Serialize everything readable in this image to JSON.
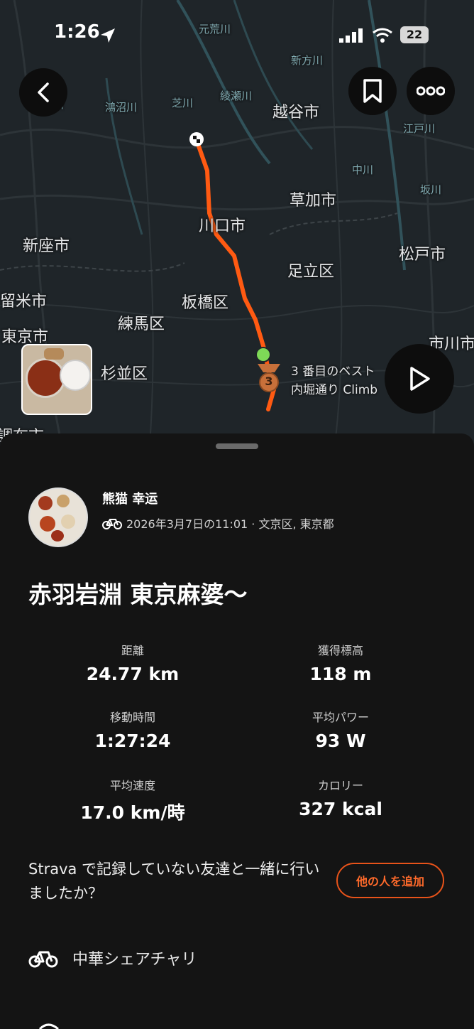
{
  "status_bar": {
    "time": "1:26",
    "battery": "22"
  },
  "map": {
    "labels": [
      "越谷市",
      "草加市",
      "川口市",
      "新座市",
      "足立区",
      "松戸市",
      "留米市",
      "板橋区",
      "練馬区",
      "東京市",
      "杉並区",
      "市川市",
      "調布市"
    ],
    "river_labels": [
      "荒川",
      "芝川",
      "綾瀬川",
      "新方川",
      "中川",
      "江戸川",
      "坂川",
      "鴻沼川",
      "元荒川"
    ],
    "segment": {
      "rank": "3",
      "line1": "3 番目のベスト",
      "line2": "内堀通り Climb"
    },
    "photo": "food-photo"
  },
  "activity": {
    "athlete": "熊猫 幸运",
    "meta": "2026年3月7日の11:01 · 文京区, 東京都",
    "title": "赤羽岩淵 東京麻婆〜",
    "stats": [
      {
        "label": "距離",
        "value": "24.77 km"
      },
      {
        "label": "獲得標高",
        "value": "118 m"
      },
      {
        "label": "移動時間",
        "value": "1:27:24"
      },
      {
        "label": "平均パワー",
        "value": "93 W"
      },
      {
        "label": "平均速度",
        "value": "17.0 km/時"
      },
      {
        "label": "カロリー",
        "value": "327 kcal"
      }
    ],
    "prompt": "Strava で記録していない友達と一緒に行いましたか？",
    "add_button": "他の人を追加",
    "gear": "中華シェアチャリ"
  },
  "colors": {
    "route": "#ff5a12",
    "accent": "#e8531a",
    "start": "#7ed957",
    "medal": "#c8703a"
  }
}
